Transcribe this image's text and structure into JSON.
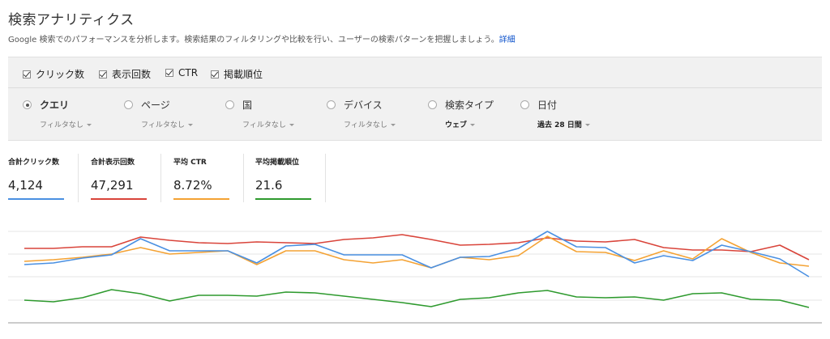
{
  "header": {
    "title": "検索アナリティクス",
    "description": "Google 検索でのパフォーマンスを分析します。検索結果のフィルタリングや比較を行い、ユーザーの検索パターンを把握しましょう。",
    "details_link": "詳細"
  },
  "metrics": [
    {
      "label": "クリック数",
      "checked": true
    },
    {
      "label": "表示回数",
      "checked": true
    },
    {
      "label": "CTR",
      "checked": true
    },
    {
      "label": "掲載順位",
      "checked": true
    }
  ],
  "groups": [
    {
      "label": "クエリ",
      "selected": true,
      "filter": "フィルタなし"
    },
    {
      "label": "ページ",
      "selected": false,
      "filter": "フィルタなし"
    },
    {
      "label": "国",
      "selected": false,
      "filter": "フィルタなし"
    },
    {
      "label": "デバイス",
      "selected": false,
      "filter": "フィルタなし"
    },
    {
      "label": "検索タイプ",
      "selected": false,
      "filter": "ウェブ"
    },
    {
      "label": "日付",
      "selected": false,
      "filter": "過去 28 日間"
    }
  ],
  "summary": [
    {
      "title": "合計クリック数",
      "value": "4,124",
      "color": "#4a90e2"
    },
    {
      "title": "合計表示回数",
      "value": "47,291",
      "color": "#d9443a"
    },
    {
      "title": "平均 CTR",
      "value": "8.72%",
      "color": "#f4a233"
    },
    {
      "title": "平均掲載順位",
      "value": "21.6",
      "color": "#2e9a2e"
    }
  ],
  "chart_data": {
    "type": "line",
    "x": [
      1,
      2,
      3,
      4,
      5,
      6,
      7,
      8,
      9,
      10,
      11,
      12,
      13,
      14,
      15,
      16,
      17,
      18,
      19,
      20,
      21,
      22,
      23,
      24,
      25,
      26,
      27,
      28
    ],
    "series": [
      {
        "color": "#d9443a",
        "values": [
          307,
          307,
          305,
          305,
          293,
          297,
          300,
          301,
          299,
          300,
          301,
          296,
          294,
          290,
          296,
          303,
          302,
          300,
          294,
          298,
          299,
          296,
          306,
          309,
          309,
          311,
          303,
          321
        ]
      },
      {
        "color": "#f4a233",
        "values": [
          323,
          321,
          318,
          314,
          306,
          314,
          312,
          310,
          327,
          310,
          310,
          321,
          325,
          321,
          331,
          318,
          321,
          316,
          292,
          311,
          312,
          322,
          310,
          320,
          295,
          312,
          325,
          329
        ]
      },
      {
        "color": "#4a90e2",
        "values": [
          327,
          325,
          319,
          315,
          295,
          310,
          310,
          310,
          325,
          304,
          302,
          315,
          315,
          315,
          331,
          318,
          317,
          307,
          286,
          305,
          306,
          325,
          316,
          322,
          303,
          311,
          320,
          342
        ]
      },
      {
        "color": "#2e9a2e",
        "values": [
          371,
          373,
          368,
          358,
          363,
          372,
          365,
          365,
          366,
          361,
          362,
          366,
          370,
          374,
          379,
          370,
          368,
          362,
          359,
          367,
          368,
          367,
          371,
          363,
          362,
          370,
          371,
          380
        ]
      }
    ]
  }
}
